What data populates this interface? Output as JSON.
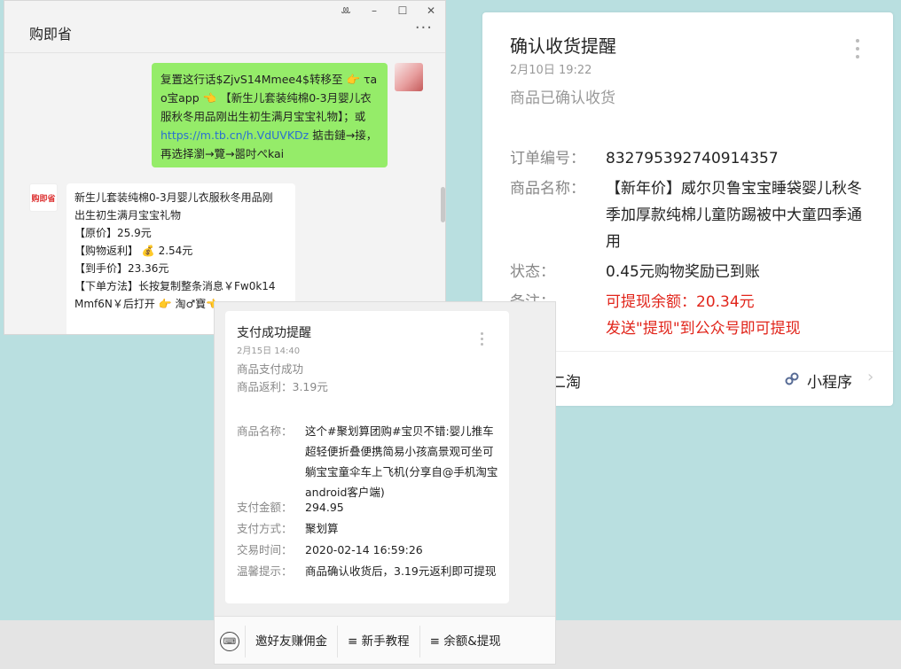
{
  "chat_window": {
    "title": "购即省",
    "controls": {
      "pin": "ꔛ",
      "minimize": "–",
      "maximize": "☐",
      "close": "✕"
    },
    "more": "···",
    "sent_message": {
      "line1": "复置这行话$ZjvS14Mmee4$转移至 👉 τa",
      "line2": "o宝app 👈 【新生儿套装纯棉0-3月婴儿衣",
      "line3": "服秋冬用品刚出生初生满月宝宝礼物】；或",
      "link": "https://m.tb.cn/h.VdUVKDz",
      "line4_suffix": " 掂击鏈→接，",
      "line5": "再选择瀏→覽→噐吋ぺkai"
    },
    "bot_avatar_text": "购即省",
    "received_message": {
      "line1": "新生儿套装纯棉0-3月婴儿衣服秋冬用品刚",
      "line2": "出生初生满月宝宝礼物",
      "line3": "【原价】25.9元",
      "line4": "【购物返利】 💰 2.54元",
      "line5": "【到手价】23.36元",
      "line6": "【下单方法】长按复制整条消息￥Fw0k14",
      "line7": "Mmf6N￥后打开 👉 淘♂寶👈"
    }
  },
  "confirm_card": {
    "title": "确认收货提醒",
    "date": "2月10日  19:22",
    "subtitle": "商品已确认收货",
    "rows": [
      {
        "label": "订单编号：",
        "value": "832795392740914357"
      },
      {
        "label": "商品名称：",
        "value": "【新年价】威尔贝鲁宝宝睡袋婴儿秋冬季加厚款纯棉儿童防踢被中大童四季通用"
      },
      {
        "label": "状态：",
        "value": "0.45元购物奖励已到账"
      },
      {
        "label": "备注：",
        "value_line1": "可提现余额：20.34元",
        "value_line2": "发送\"提现\"到公众号即可提现"
      }
    ],
    "brand": "小二淘",
    "mini_program": "小程序",
    "chevron": "›"
  },
  "pay_card": {
    "title": "支付成功提醒",
    "date": "2月15日  14:40",
    "subtitle_line1": "商品支付成功",
    "subtitle_line2": "商品返利：3.19元",
    "rows": [
      {
        "label": "商品名称：",
        "value": "这个#聚划算团购#宝贝不错:婴儿推车超轻便折叠便携简易小孩高景观可坐可躺宝宝童伞车上飞机(分享自@手机淘宝android客户端)"
      },
      {
        "label": "支付金额：",
        "value": "294.95"
      },
      {
        "label": "支付方式：",
        "value": "聚划算"
      },
      {
        "label": "交易时间：",
        "value": "2020-02-14 16:59:26"
      },
      {
        "label": "温馨提示：",
        "value": "商品确认收货后，3.19元返利即可提现"
      }
    ],
    "menu": [
      "邀好友赚佣金",
      "≡ 新手教程",
      "≡ 余额&提现"
    ],
    "colors": {
      "alert": "#e1251b"
    }
  }
}
